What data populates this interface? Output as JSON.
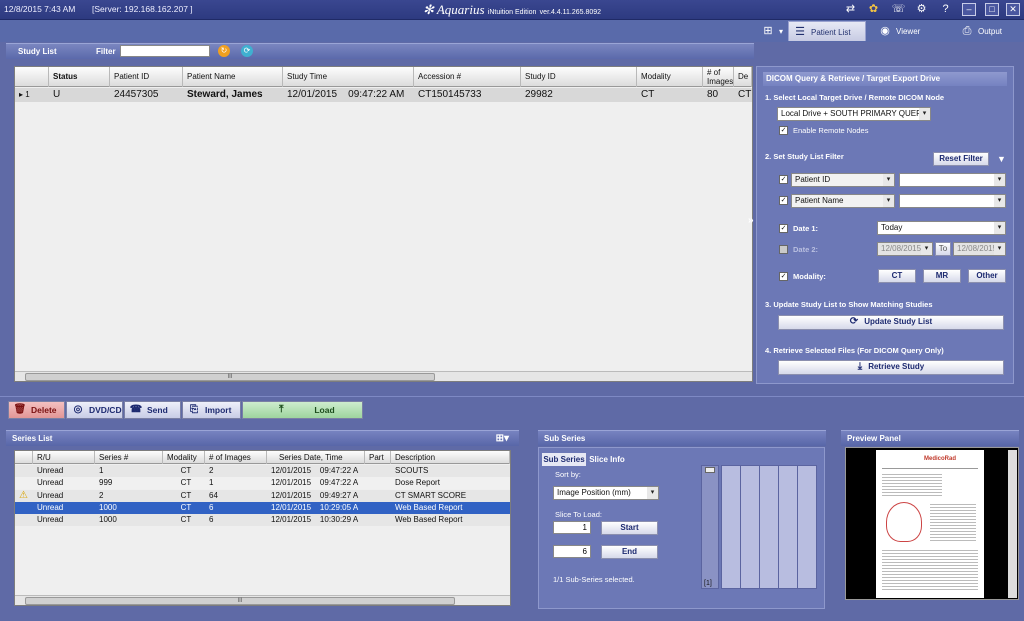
{
  "topbar": {
    "datetime": "12/8/2015  7:43 AM",
    "server": "[Server: 192.168.162.207 ]",
    "app_title": "Aquarius",
    "app_subtitle": "iNtuition Edition",
    "version": "ver.4.4.11.265.8092"
  },
  "nav_tabs": [
    {
      "label": "Patient List"
    },
    {
      "label": "Viewer"
    },
    {
      "label": "Output"
    }
  ],
  "study_list": {
    "title": "Study List",
    "filter_label": "Filter",
    "filter_value": "",
    "columns": [
      "Status",
      "Patient ID",
      "Patient Name",
      "Study Time",
      "Accession #",
      "Study ID",
      "Modality",
      "# of Images",
      "De"
    ],
    "rows": [
      {
        "index": "1",
        "status": "U",
        "patient_id": "24457305",
        "patient_name": "Steward, James",
        "study_time": "12/01/2015    09:47:22 AM",
        "accession": "CT150145733",
        "study_id": "29982",
        "modality": "CT",
        "images": "80",
        "de": "CT"
      }
    ],
    "scroll_thumb": "III"
  },
  "dicom_panel": {
    "title": "DICOM Query & Retrieve / Target Export Drive",
    "step1": "1. Select Local Target Drive / Remote DICOM Node",
    "target_drive": "Local Drive + SOUTH PRIMARY QUERY",
    "enable_remote": "Enable Remote Nodes",
    "step2": "2. Set Study List Filter",
    "reset_filter": "Reset Filter",
    "filter1_field": "Patient ID",
    "filter2_field": "Patient Name",
    "date1_label": "Date 1:",
    "date1_value": "Today",
    "date2_label": "Date 2:",
    "date2_from": "12/08/2015",
    "to_label": "To",
    "date2_to": "12/08/2015",
    "modality_label": "Modality:",
    "modality_buttons": [
      "CT",
      "MR",
      "Other"
    ],
    "step3": "3. Update Study List to Show Matching Studies",
    "update_button": "Update Study List",
    "step4": "4. Retrieve Selected Files (For DICOM Query Only)",
    "retrieve_button": "Retrieve Study"
  },
  "actions": {
    "delete": "Delete",
    "dvd": "DVD/CD",
    "send": "Send",
    "import": "Import",
    "load": "Load"
  },
  "series_list": {
    "title": "Series List",
    "columns": [
      "R/U",
      "Series #",
      "Modality",
      "# of Images",
      "Series Date, Time",
      "Part",
      "Description"
    ],
    "rows": [
      {
        "ru": "Unread",
        "series": "1",
        "modality": "CT",
        "images": "2",
        "datetime": "12/01/2015    09:47:22 A",
        "part": "",
        "description": "SCOUTS",
        "warn": false,
        "selected": false
      },
      {
        "ru": "Unread",
        "series": "999",
        "modality": "CT",
        "images": "1",
        "datetime": "12/01/2015    09:47:22 A",
        "part": "",
        "description": "Dose Report",
        "warn": false,
        "selected": false
      },
      {
        "ru": "Unread",
        "series": "2",
        "modality": "CT",
        "images": "64",
        "datetime": "12/01/2015    09:49:27 A",
        "part": "",
        "description": "CT SMART SCORE",
        "warn": true,
        "selected": false
      },
      {
        "ru": "Unread",
        "series": "1000",
        "modality": "CT",
        "images": "6",
        "datetime": "12/01/2015    10:29:05 A",
        "part": "",
        "description": "Web Based Report",
        "warn": false,
        "selected": true
      },
      {
        "ru": "Unread",
        "series": "1000",
        "modality": "CT",
        "images": "6",
        "datetime": "12/01/2015    10:30:29 A",
        "part": "",
        "description": "Web Based Report",
        "warn": false,
        "selected": false
      }
    ],
    "scroll_thumb": "III"
  },
  "sub_series": {
    "title": "Sub Series",
    "tab1": "Sub Series",
    "tab2": "Slice Info",
    "sort_by_label": "Sort by:",
    "sort_by_value": "Image Position (mm)",
    "slice_to_load_label": "Slice To Load:",
    "start_value": "1",
    "start_button": "Start",
    "end_value": "6",
    "end_button": "End",
    "status": "1/1 Sub-Series selected.",
    "counter": "[1]"
  },
  "preview": {
    "title": "Preview Panel",
    "logo": "MedicoRad"
  },
  "colors": {
    "background": "#5f6aa6",
    "selection": "#3162c4",
    "delete": "#e8a0a0",
    "load": "#a8dca8"
  }
}
